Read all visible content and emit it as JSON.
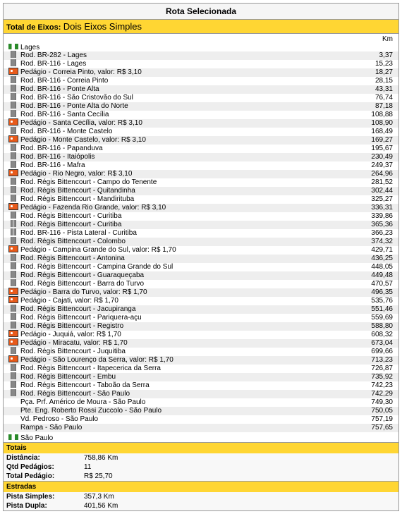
{
  "title": "Rota Selecionada",
  "eixos": {
    "label": "Total de Eixos:",
    "value": "Dois Eixos Simples"
  },
  "header": {
    "km": "Km"
  },
  "origin": {
    "label": "Lages"
  },
  "destination": {
    "label": "São Paulo"
  },
  "rows": [
    {
      "icon": "road",
      "label": "Rod. BR-282 - Lages",
      "km": "3,37"
    },
    {
      "icon": "road",
      "label": "Rod. BR-116 - Lages",
      "km": "15,23"
    },
    {
      "icon": "toll",
      "label": "Pedágio - Correia Pinto, valor: R$ 3,10",
      "km": "18,27"
    },
    {
      "icon": "road",
      "label": "Rod. BR-116 - Correia Pinto",
      "km": "28,15"
    },
    {
      "icon": "road",
      "label": "Rod. BR-116 - Ponte Alta",
      "km": "43,31"
    },
    {
      "icon": "road",
      "label": "Rod. BR-116 - São Cristovão do Sul",
      "km": "76,74"
    },
    {
      "icon": "road",
      "label": "Rod. BR-116 - Ponte Alta do Norte",
      "km": "87,18"
    },
    {
      "icon": "road",
      "label": "Rod. BR-116 - Santa Cecília",
      "km": "108,88"
    },
    {
      "icon": "toll",
      "label": "Pedágio - Santa Cecília, valor: R$ 3,10",
      "km": "108,90"
    },
    {
      "icon": "road",
      "label": "Rod. BR-116 - Monte Castelo",
      "km": "168,49"
    },
    {
      "icon": "toll",
      "label": "Pedágio - Monte Castelo, valor: R$ 3,10",
      "km": "169,27"
    },
    {
      "icon": "road",
      "label": "Rod. BR-116 - Papanduva",
      "km": "195,67"
    },
    {
      "icon": "road",
      "label": "Rod. BR-116 - Itaiópolis",
      "km": "230,49"
    },
    {
      "icon": "road",
      "label": "Rod. BR-116 - Mafra",
      "km": "249,37"
    },
    {
      "icon": "toll",
      "label": "Pedágio - Rio Negro, valor: R$ 3,10",
      "km": "264,96"
    },
    {
      "icon": "road",
      "label": "Rod. Régis Bittencourt - Campo do Tenente",
      "km": "281,52"
    },
    {
      "icon": "road",
      "label": "Rod. Régis Bittencourt - Quitandinha",
      "km": "302,44"
    },
    {
      "icon": "road",
      "label": "Rod. Régis Bittencourt - Mandirituba",
      "km": "325,27"
    },
    {
      "icon": "toll",
      "label": "Pedágio - Fazenda Rio Grande, valor: R$ 3,10",
      "km": "336,31"
    },
    {
      "icon": "road",
      "label": "Rod. Régis Bittencourt - Curitiba",
      "km": "339,86"
    },
    {
      "icon": "hwy",
      "label": "Rod. Régis Bittencourt - Curitiba",
      "km": "365,36"
    },
    {
      "icon": "hwy",
      "label": "Rod. BR-116 - Pista Lateral - Curitiba",
      "km": "366,23"
    },
    {
      "icon": "road",
      "label": "Rod. Régis Bittencourt - Colombo",
      "km": "374,32"
    },
    {
      "icon": "toll",
      "label": "Pedágio - Campina Grande do Sul, valor: R$ 1,70",
      "km": "429,71"
    },
    {
      "icon": "road",
      "label": "Rod. Régis Bittencourt - Antonina",
      "km": "436,25"
    },
    {
      "icon": "road",
      "label": "Rod. Régis Bittencourt - Campina Grande do Sul",
      "km": "448,05"
    },
    {
      "icon": "road",
      "label": "Rod. Régis Bittencourt - Guaraqueçaba",
      "km": "449,48"
    },
    {
      "icon": "road",
      "label": "Rod. Régis Bittencourt - Barra do Turvo",
      "km": "470,57"
    },
    {
      "icon": "toll",
      "label": "Pedágio - Barra do Turvo, valor: R$ 1,70",
      "km": "496,35"
    },
    {
      "icon": "toll",
      "label": "Pedágio - Cajati, valor: R$ 1,70",
      "km": "535,76"
    },
    {
      "icon": "road",
      "label": "Rod. Régis Bittencourt - Jacupiranga",
      "km": "551,46"
    },
    {
      "icon": "road",
      "label": "Rod. Régis Bittencourt - Pariquera-açu",
      "km": "559,69"
    },
    {
      "icon": "road",
      "label": "Rod. Régis Bittencourt - Registro",
      "km": "588,80"
    },
    {
      "icon": "toll",
      "label": "Pedágio - Juquiá, valor: R$ 1,70",
      "km": "608,32"
    },
    {
      "icon": "toll",
      "label": "Pedágio - Miracatu, valor: R$ 1,70",
      "km": "673,04"
    },
    {
      "icon": "road",
      "label": "Rod. Régis Bittencourt - Juquitiba",
      "km": "699,66"
    },
    {
      "icon": "toll",
      "label": "Pedágio - São Lourenço da Serra, valor: R$ 1,70",
      "km": "713,23"
    },
    {
      "icon": "road",
      "label": "Rod. Régis Bittencourt - Itapecerica da Serra",
      "km": "726,87"
    },
    {
      "icon": "road",
      "label": "Rod. Régis Bittencourt - Embu",
      "km": "735,92"
    },
    {
      "icon": "road",
      "label": "Rod. Régis Bittencourt - Taboão da Serra",
      "km": "742,23"
    },
    {
      "icon": "road",
      "label": "Rod. Régis Bittencourt - São Paulo",
      "km": "742,29"
    },
    {
      "icon": "none",
      "label": "Pça. Prf. Américo de Moura - São Paulo",
      "km": "749,30"
    },
    {
      "icon": "none",
      "label": "Pte. Eng. Roberto Rossi Zuccolo - São Paulo",
      "km": "750,05"
    },
    {
      "icon": "none",
      "label": "Vd. Pedroso - São Paulo",
      "km": "757,19"
    },
    {
      "icon": "none",
      "label": "Rampa - São Paulo",
      "km": "757,65"
    }
  ],
  "totais": {
    "title": "Totais",
    "distancia_label": "Distância:",
    "distancia": "758,86 Km",
    "qtd_label": "Qtd Pedágios:",
    "qtd": "11",
    "total_label": "Total Pedágio:",
    "total": "R$ 25,70"
  },
  "estradas": {
    "title": "Estradas",
    "simples_label": "Pista Simples:",
    "simples": "357,3 Km",
    "dupla_label": "Pista Dupla:",
    "dupla": "401,56 Km"
  }
}
